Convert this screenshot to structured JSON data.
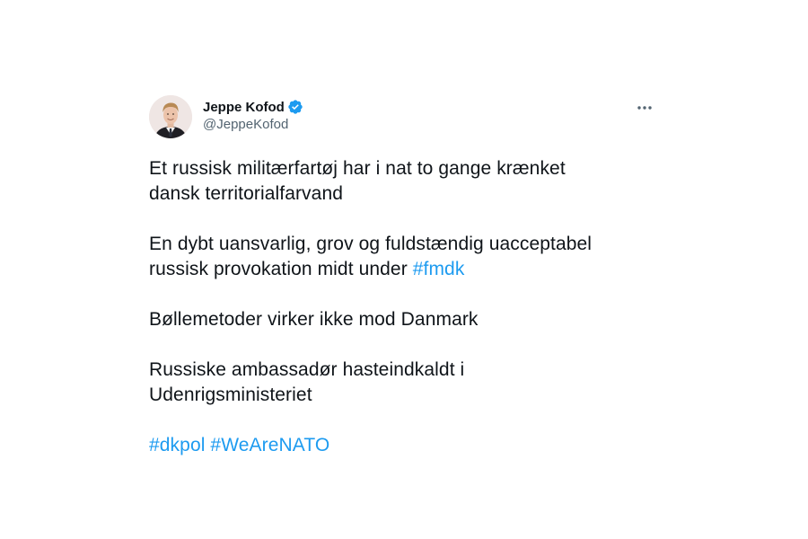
{
  "author": {
    "display_name": "Jeppe Kofod",
    "handle": "@JeppeKofod",
    "verified": true,
    "avatar_icon": "profile-photo"
  },
  "menu_icon": "more-dots-icon",
  "colors": {
    "text": "#0f1419",
    "secondary": "#536471",
    "link": "#1d9bf0",
    "verified_badge": "#1d9bf0"
  },
  "tweet": {
    "line1": "Et russisk militærfartøj har i nat to gange krænket",
    "line2": "dansk territorialfarvand",
    "line3": "En dybt uansvarlig, grov og fuldstændig uacceptabel",
    "line4_text": "russisk provokation midt under ",
    "line4_hashtag": "#fmdk",
    "line5": "Bøllemetoder virker ikke mod Danmark",
    "line6": "Russiske ambassadør hasteindkaldt i",
    "line7": "Udenrigsministeriet",
    "hashtag_dkpol": "#dkpol",
    "hashtag_wearenato": "#WeAreNATO"
  }
}
